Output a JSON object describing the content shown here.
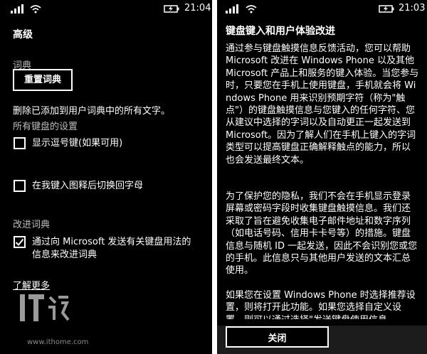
{
  "left": {
    "status": {
      "time": "21:04"
    },
    "page_title": "高级",
    "dictionary": {
      "section_label": "词典",
      "reset_button": "重置词典",
      "description": "删除已添加到用户词典中的所有文字。"
    },
    "keyboard_settings": {
      "section_label": "所有键盘的设置",
      "options": [
        {
          "label": "显示逗号键(如果可用)",
          "checked": false
        },
        {
          "label": "在我键入图释后切换回字母",
          "checked": false
        }
      ]
    },
    "improve": {
      "section_label": "改进词典",
      "option_line1": "通过向 Microsoft 发送有关键盘用法的",
      "option_line2": "信息来改进词典",
      "checked": true
    },
    "learn_more": "了解更多",
    "watermark": {
      "logo_text": "IT之家",
      "url": "www.ithome.com"
    }
  },
  "right": {
    "status": {
      "time": "21:03"
    },
    "page_title": "键盘键入和用户体验改进",
    "paragraphs": [
      "通过参与键盘触摸信息反馈活动，您可以帮助 Microsoft 改进在 Windows Phone 以及其他 Microsoft 产品上和服务的键入体验。当您参与时，只要您在手机上使用键盘，手机就会将 Windows Phone 用来识别预期字符（称为\"触点\"）的键盘触摸信息与您键入的任何字符、您从建议中选择的字词以及自动更正一起发送到 Microsoft。因为了解人们在手机上键入的字词类型可以提高键盘正确解释触点的能力，所以也会发送最终文本。",
      "为了保护您的隐私，我们不会在手机显示登录屏幕或密码字段时收集键盘触摸信息。我们还采取了旨在避免收集电子邮件地址和数字序列（如电话号码、信用卡卡号等）的措施。键盘信息与随机 ID 一起发送，因此不会识别您或您的手机。此信息只与其他用户发送的文本汇总使用。",
      "如果您在设置 Windows Phone 时选择推荐设置，则将打开此功能。如果您选择自定义设置，则可以通过选择\"发送键盘使用信息"
    ],
    "close_button": "关闭"
  }
}
